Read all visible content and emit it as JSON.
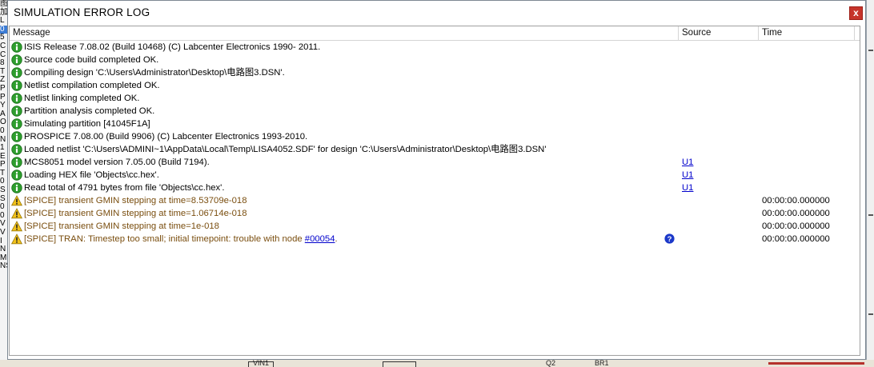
{
  "window": {
    "title": "SIMULATION ERROR LOG",
    "close_glyph": "x"
  },
  "columns": {
    "message": "Message",
    "source": "Source",
    "time": "Time"
  },
  "rows": [
    {
      "type": "info",
      "message": "ISIS Release 7.08.02 (Build 10468) (C) Labcenter Electronics 1990- 2011.",
      "source": "",
      "time": ""
    },
    {
      "type": "info",
      "message": "Source code build completed OK.",
      "source": "",
      "time": ""
    },
    {
      "type": "info",
      "message": "Compiling design 'C:\\Users\\Administrator\\Desktop\\电路图3.DSN'.",
      "source": "",
      "time": ""
    },
    {
      "type": "info",
      "message": "Netlist compilation completed OK.",
      "source": "",
      "time": ""
    },
    {
      "type": "info",
      "message": "Netlist linking completed OK.",
      "source": "",
      "time": ""
    },
    {
      "type": "info",
      "message": "Partition analysis completed OK.",
      "source": "",
      "time": ""
    },
    {
      "type": "info",
      "message": "Simulating partition [41045F1A]",
      "source": "",
      "time": ""
    },
    {
      "type": "info",
      "message": "PROSPICE 7.08.00 (Build 9906) (C) Labcenter Electronics 1993-2010.",
      "source": "",
      "time": ""
    },
    {
      "type": "info",
      "message": "Loaded netlist 'C:\\Users\\ADMINI~1\\AppData\\Local\\Temp\\LISA4052.SDF' for design 'C:\\Users\\Administrator\\Desktop\\电路图3.DSN'",
      "source": "",
      "time": ""
    },
    {
      "type": "info",
      "message": "MCS8051 model version 7.05.00 (Build 7194).",
      "source": "U1",
      "time": ""
    },
    {
      "type": "info",
      "message": "Loading HEX file 'Objects\\cc.hex'.",
      "source": "U1",
      "time": ""
    },
    {
      "type": "info",
      "message": "Read total of 4791 bytes from file 'Objects\\cc.hex'.",
      "source": "U1",
      "time": ""
    },
    {
      "type": "warn",
      "message": "[SPICE] transient GMIN stepping at time=8.53709e-018",
      "source": "",
      "time": "00:00:00.000000"
    },
    {
      "type": "warn",
      "message": "[SPICE] transient GMIN stepping at time=1.06714e-018",
      "source": "",
      "time": "00:00:00.000000"
    },
    {
      "type": "warn",
      "message": "[SPICE] transient GMIN stepping at time=1e-018",
      "source": "",
      "time": "00:00:00.000000"
    },
    {
      "type": "warn",
      "message": "[SPICE] TRAN:  Timestep too small; initial timepoint: trouble with node ",
      "link": "#00054",
      "suffix": ".",
      "source": "",
      "help": true,
      "time": "00:00:00.000000"
    }
  ],
  "background": {
    "left_chars": [
      "图",
      "加",
      "L",
      "0",
      "5",
      "C",
      "C",
      "8",
      "T",
      "Z",
      "P",
      "P",
      "Y",
      "A",
      "O",
      "0",
      "N",
      "1",
      "E",
      "P",
      "T",
      "0",
      "S",
      "S",
      "0",
      "0",
      "V",
      "V",
      "I",
      "N",
      "M",
      "NSS"
    ],
    "bottom_labels": [
      "BR1",
      "Q2",
      "VIN1"
    ]
  },
  "colors": {
    "info_icon": "#2e9e2e",
    "warn_icon": "#f2c21b",
    "warn_text": "#7a4e0f",
    "link": "#0000cc",
    "close": "#c6342b"
  }
}
